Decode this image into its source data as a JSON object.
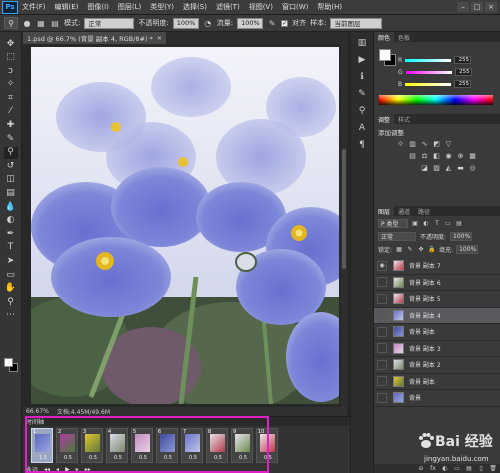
{
  "menubar": {
    "logo": "Ps",
    "items": [
      "文件(F)",
      "编辑(E)",
      "图像(I)",
      "图层(L)",
      "类型(Y)",
      "选择(S)",
      "滤镜(T)",
      "视图(V)",
      "窗口(W)",
      "帮助(H)"
    ],
    "window_buttons": [
      "–",
      "□",
      "×"
    ]
  },
  "options": {
    "mode_label": "模式:",
    "mode_value": "正常",
    "opacity_label": "不透明度:",
    "opacity_value": "100%",
    "flow_label": "流量:",
    "flow_value": "100%",
    "align_label": "对齐",
    "sample_label": "样本:",
    "sample_value": "当前图层"
  },
  "document": {
    "tab_title": "1.psd @ 66.7% (背景 副本 4, RGB/8#) *",
    "tab_close": "×",
    "zoom": "66.67%",
    "doc_info": "文档:4.45M/49.6M"
  },
  "timeline": {
    "title": "时间轴",
    "frames": [
      {
        "num": "1",
        "delay": "1.5"
      },
      {
        "num": "2",
        "delay": "0.5"
      },
      {
        "num": "3",
        "delay": "0.5"
      },
      {
        "num": "4",
        "delay": "0.5"
      },
      {
        "num": "5",
        "delay": "0.5"
      },
      {
        "num": "6",
        "delay": "0.5"
      },
      {
        "num": "7",
        "delay": "0.5"
      },
      {
        "num": "8",
        "delay": "0.5"
      },
      {
        "num": "9",
        "delay": "0.5"
      },
      {
        "num": "10",
        "delay": "0.5"
      }
    ],
    "loop_label": "永远",
    "controls": [
      "◂◂",
      "◂",
      "▶",
      "▸",
      "▸▸"
    ]
  },
  "color_panel": {
    "tabs": [
      "颜色",
      "色板"
    ],
    "channels": [
      {
        "label": "R",
        "value": "255"
      },
      {
        "label": "G",
        "value": "255"
      },
      {
        "label": "B",
        "value": "255"
      }
    ]
  },
  "adjustments_panel": {
    "tabs": [
      "调整",
      "样式"
    ],
    "title": "添加调整"
  },
  "layers_panel": {
    "tabs": [
      "图层",
      "通道",
      "路径"
    ],
    "kind_filter": "P 类型",
    "blend_mode": "正常",
    "opacity_label": "不透明度:",
    "opacity_value": "100%",
    "lock_label": "锁定:",
    "fill_label": "填充:",
    "fill_value": "100%",
    "layers": [
      {
        "name": "背景 副本 7",
        "visible": true
      },
      {
        "name": "背景 副本 6",
        "visible": false
      },
      {
        "name": "背景 副本 5",
        "visible": false
      },
      {
        "name": "背景 副本 4",
        "visible": false,
        "selected": true
      },
      {
        "name": "背景 副本",
        "visible": false
      },
      {
        "name": "背景 副本 3",
        "visible": false
      },
      {
        "name": "背景 副本 2",
        "visible": false
      },
      {
        "name": "背景 副本",
        "visible": false
      },
      {
        "name": "背景",
        "visible": false
      }
    ],
    "footer_icons": [
      "⊖",
      "fx",
      "◐",
      "▭",
      "▤",
      "▯",
      "🗑"
    ]
  },
  "watermark": {
    "brand": "Bai 经验",
    "url": "jingyan.baidu.com"
  }
}
